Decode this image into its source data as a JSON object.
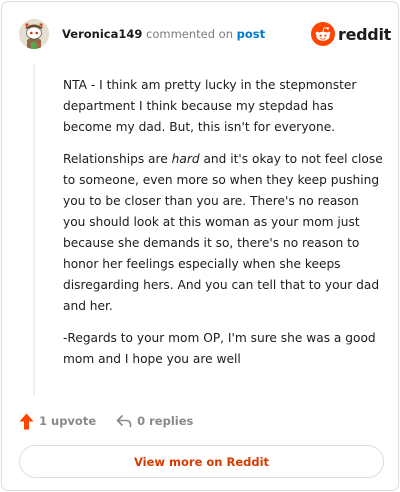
{
  "header": {
    "username": "Veronica149",
    "commented_text": "commented on",
    "post_link": "post",
    "logo_text": "reddit"
  },
  "comment": {
    "paragraph1": "NTA - I think am pretty lucky in the stepmonster department I think because my stepdad has become my dad. But, this isn't for everyone.",
    "paragraph2_before": "Relationships are ",
    "paragraph2_emphasis": "hard",
    "paragraph2_after": " and it's okay to not feel close to someone, even more so when they keep pushing you to be closer than you are. There's no reason you should look at this woman as your mom just because she demands it so, there's no reason to honor her feelings especially when she keeps disregarding hers. And you can tell that to your dad and her.",
    "paragraph3": "-Regards to your mom OP, I'm sure she was a good mom and I hope you are well"
  },
  "actions": {
    "upvote_label": "1 upvote",
    "replies_label": "0 replies"
  },
  "footer": {
    "view_more_label": "View more on Reddit"
  },
  "colors": {
    "accent": "#ff4500",
    "link": "#0079d3",
    "view_more": "#d93a00"
  },
  "icons": {
    "avatar": "snoo-avatar",
    "logo": "reddit-snoo-icon",
    "upvote": "upvote-arrow-icon",
    "reply": "reply-arrow-icon"
  }
}
